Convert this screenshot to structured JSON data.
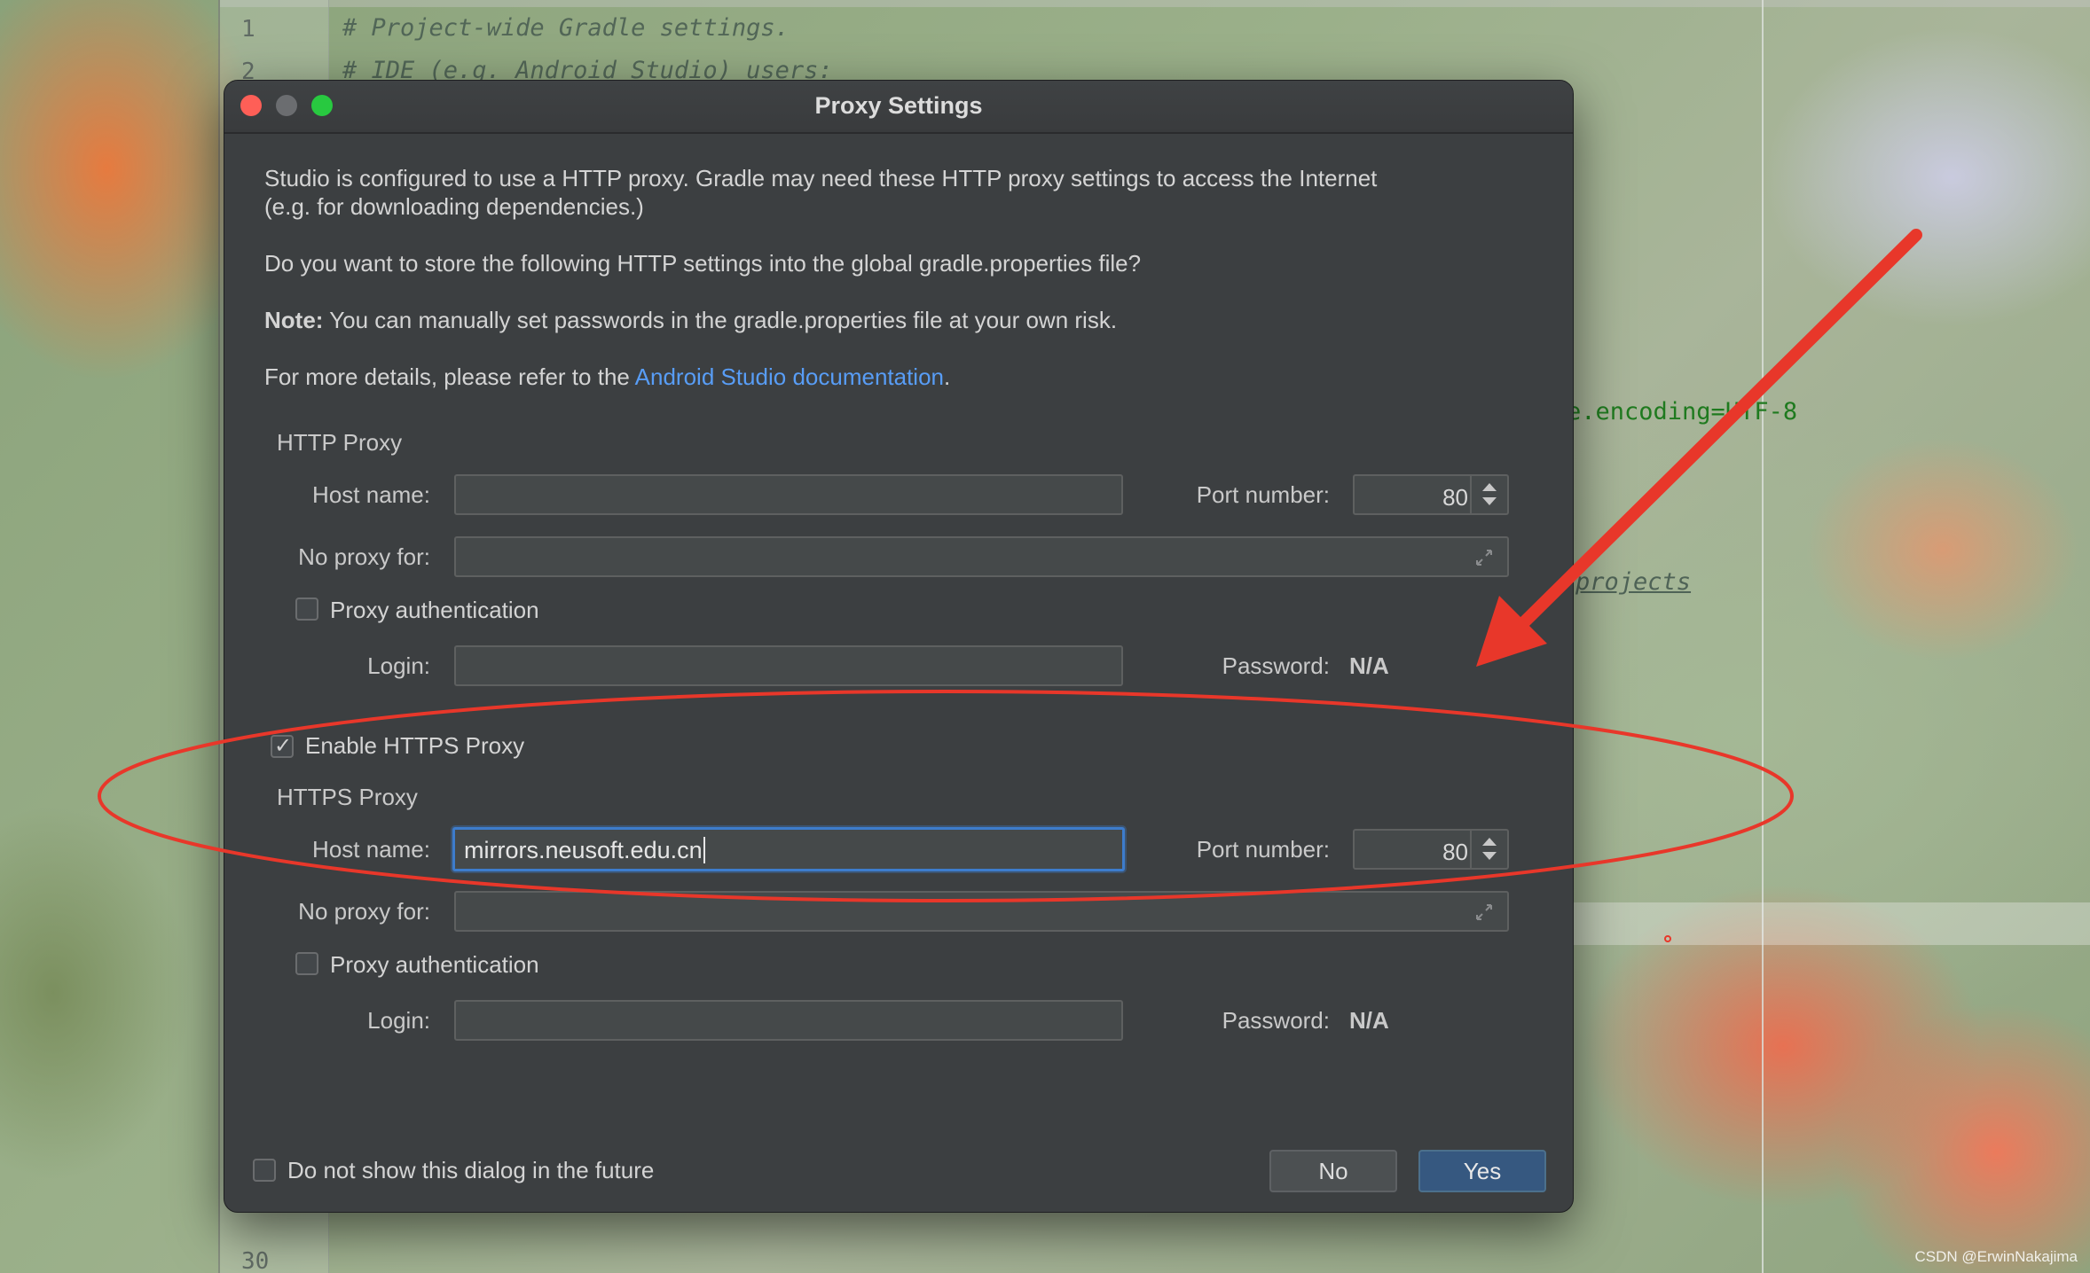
{
  "editor": {
    "line_numbers": [
      "1",
      "2",
      "30"
    ],
    "line1": "# Project-wide Gradle settings.",
    "line2": "# IDE (e.g. Android Studio) users:",
    "encoding_fragment": "e.encoding=UTF-8",
    "projects_fragment": "projects"
  },
  "dialog": {
    "title": "Proxy Settings",
    "intro_line1": "Studio is configured to use a HTTP proxy. Gradle may need these HTTP proxy settings to access the Internet",
    "intro_line2": "(e.g. for downloading dependencies.)",
    "question": "Do you want to store the following HTTP settings into the global gradle.properties file?",
    "note_label": "Note:",
    "note_text": "You can manually set passwords in the gradle.properties file at your own risk.",
    "details_prefix": "For more details, please refer to the ",
    "details_link": "Android Studio documentation",
    "details_suffix": "."
  },
  "http_proxy": {
    "section_title": "HTTP Proxy",
    "host_label": "Host name:",
    "host_value": "",
    "port_label": "Port number:",
    "port_value": "80",
    "no_proxy_label": "No proxy for:",
    "no_proxy_value": "",
    "auth_label": "Proxy authentication",
    "auth_checked": false,
    "login_label": "Login:",
    "login_value": "",
    "password_label": "Password:",
    "password_value": "N/A"
  },
  "https_enable": {
    "label": "Enable HTTPS Proxy",
    "checked": true
  },
  "https_proxy": {
    "section_title": "HTTPS Proxy",
    "host_label": "Host name:",
    "host_value": "mirrors.neusoft.edu.cn",
    "port_label": "Port number:",
    "port_value": "80",
    "no_proxy_label": "No proxy for:",
    "no_proxy_value": "",
    "auth_label": "Proxy authentication",
    "auth_checked": false,
    "login_label": "Login:",
    "login_value": "",
    "password_label": "Password:",
    "password_value": "N/A"
  },
  "footer": {
    "dont_show_label": "Do not show this dialog in the future",
    "dont_show_checked": false,
    "no_label": "No",
    "yes_label": "Yes"
  },
  "watermark": "CSDN @ErwinNakajima",
  "colors": {
    "dialog_bg": "#3c3f41",
    "link": "#589df6",
    "primary_button": "#365880",
    "focus_border": "#3d7ccc",
    "annotation_red": "#e8372a",
    "close_light": "#fe5f57",
    "maximize_light": "#28c940"
  },
  "icons": [
    "close-light",
    "minimize-light",
    "maximize-light",
    "spinner-arrows-icon",
    "expand-icon",
    "checkmark-icon"
  ]
}
